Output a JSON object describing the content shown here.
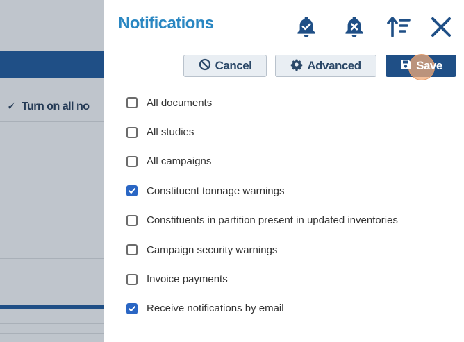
{
  "background": {
    "turn_on_label": "Turn on all no"
  },
  "panel": {
    "title": "Notifications",
    "header_icons": [
      "bell-check-icon",
      "bell-x-icon",
      "sort-asc-icon",
      "close-icon"
    ],
    "buttons": {
      "cancel": "Cancel",
      "advanced": "Advanced",
      "save": "Save"
    },
    "items": [
      {
        "label": "All documents",
        "checked": false
      },
      {
        "label": "All studies",
        "checked": false
      },
      {
        "label": "All campaigns",
        "checked": false
      },
      {
        "label": "Constituent tonnage warnings",
        "checked": true
      },
      {
        "label": "Constituents in partition present in updated inventories",
        "checked": false
      },
      {
        "label": "Campaign security warnings",
        "checked": false
      },
      {
        "label": "Invoice payments",
        "checked": false
      },
      {
        "label": "Receive notifications by email",
        "checked": true
      }
    ]
  },
  "colors": {
    "title": "#2a87c2",
    "primary": "#1f4f86",
    "checkbox_checked": "#2a66c4"
  }
}
